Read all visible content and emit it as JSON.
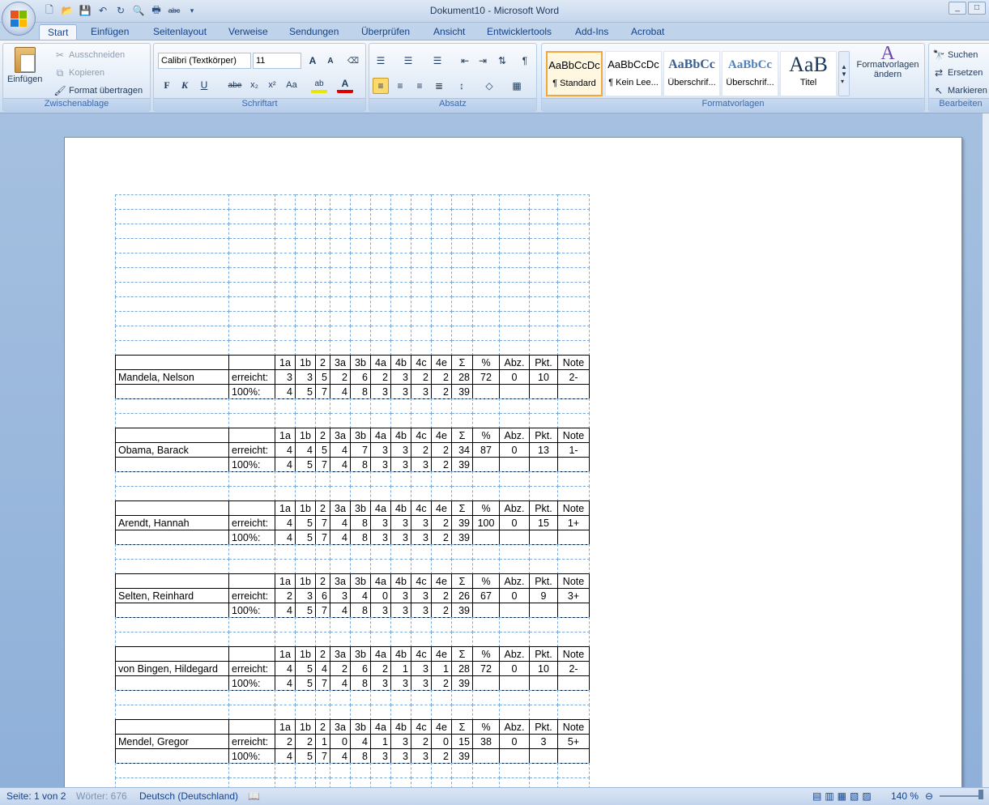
{
  "window": {
    "title": "Dokument10 - Microsoft Word",
    "min": "_",
    "max": "□"
  },
  "tabs": [
    "Start",
    "Einfügen",
    "Seitenlayout",
    "Verweise",
    "Sendungen",
    "Überprüfen",
    "Ansicht",
    "Entwicklertools",
    "Add-Ins",
    "Acrobat"
  ],
  "ribbon": {
    "clipboard": {
      "label": "Zwischenablage",
      "paste": "Einfügen",
      "cut": "Ausschneiden",
      "copy": "Kopieren",
      "format_painter": "Format übertragen"
    },
    "font": {
      "label": "Schriftart",
      "name": "Calibri (Textkörper)",
      "size": "11",
      "bold": "F",
      "italic": "K",
      "underline": "U",
      "strike": "abe",
      "sub": "x₂",
      "sup": "x²",
      "case": "Aa"
    },
    "paragraph": {
      "label": "Absatz"
    },
    "styles": {
      "label": "Formatvorlagen",
      "items": [
        {
          "preview": "AaBbCcDc",
          "name": "¶ Standard"
        },
        {
          "preview": "AaBbCcDc",
          "name": "¶ Kein Lee..."
        },
        {
          "preview": "AaBbCc",
          "name": "Überschrif..."
        },
        {
          "preview": "AaBbCc",
          "name": "Überschrif..."
        },
        {
          "preview": "AaB",
          "name": "Titel"
        }
      ],
      "change": "Formatvorlagen ändern"
    },
    "editing": {
      "label": "Bearbeiten",
      "find": "Suchen",
      "replace": "Ersetzen",
      "select": "Markieren"
    }
  },
  "table": {
    "headers": [
      "1a",
      "1b",
      "2",
      "3a",
      "3b",
      "4a",
      "4b",
      "4c",
      "4e",
      "Σ",
      "%",
      "Abz.",
      "Pkt.",
      "Note"
    ],
    "achieved_label": "erreicht:",
    "max_label": "100%:",
    "max_values": [
      "4",
      "5",
      "7",
      "4",
      "8",
      "3",
      "3",
      "3",
      "2",
      "39"
    ],
    "students": [
      {
        "name": "Mandela, Nelson",
        "values": [
          "3",
          "3",
          "5",
          "2",
          "6",
          "2",
          "3",
          "2",
          "2",
          "28",
          "72",
          "0",
          "10",
          "2-"
        ]
      },
      {
        "name": "Obama, Barack",
        "values": [
          "4",
          "4",
          "5",
          "4",
          "7",
          "3",
          "3",
          "2",
          "2",
          "34",
          "87",
          "0",
          "13",
          "1-"
        ]
      },
      {
        "name": "Arendt, Hannah",
        "values": [
          "4",
          "5",
          "7",
          "4",
          "8",
          "3",
          "3",
          "3",
          "2",
          "39",
          "100",
          "0",
          "15",
          "1+"
        ]
      },
      {
        "name": "Selten, Reinhard",
        "values": [
          "2",
          "3",
          "6",
          "3",
          "4",
          "0",
          "3",
          "3",
          "2",
          "26",
          "67",
          "0",
          "9",
          "3+"
        ]
      },
      {
        "name": "von Bingen, Hildegard",
        "values": [
          "4",
          "5",
          "4",
          "2",
          "6",
          "2",
          "1",
          "3",
          "1",
          "28",
          "72",
          "0",
          "10",
          "2-"
        ]
      },
      {
        "name": "Mendel, Gregor",
        "values": [
          "2",
          "2",
          "1",
          "0",
          "4",
          "1",
          "3",
          "2",
          "0",
          "15",
          "38",
          "0",
          "3",
          "5+"
        ]
      }
    ]
  },
  "status": {
    "page": "Seite: 1 von 2",
    "words": "Wörter: 676",
    "language": "Deutsch (Deutschland)",
    "zoom": "140 %"
  }
}
